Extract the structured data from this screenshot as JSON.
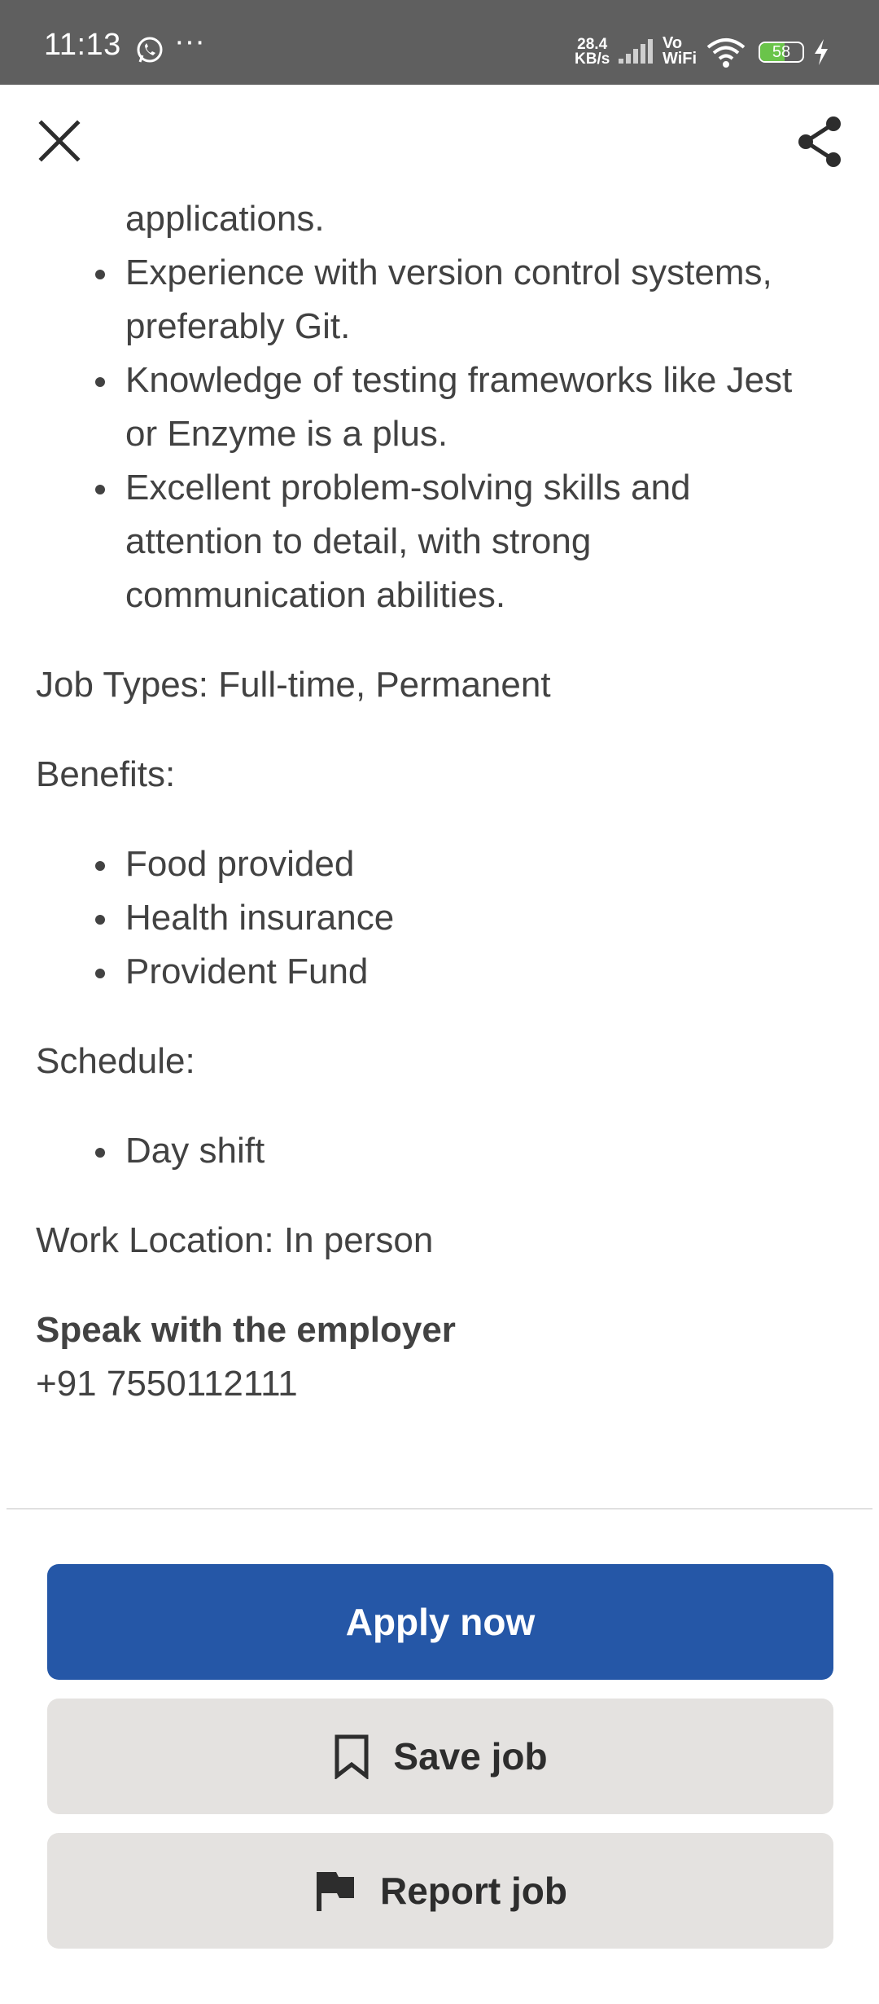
{
  "status_bar": {
    "time": "11:13",
    "dots": "···",
    "speed_value": "28.4",
    "speed_unit": "KB/s",
    "network_vo": "Vo",
    "network_wifi": "WiFi",
    "battery_level": "58",
    "battery_fraction": 0.58,
    "icons": [
      "whatsapp-icon",
      "signal-icon",
      "wifi-icon",
      "battery-icon",
      "charging-bolt-icon"
    ]
  },
  "header": {
    "icons": [
      "close-icon",
      "share-icon"
    ]
  },
  "requirements": {
    "continuation": "applications.",
    "items": [
      [
        "Experience with version control systems,",
        "preferably Git."
      ],
      [
        "Knowledge of testing frameworks like Jest",
        "or Enzyme is a plus."
      ],
      [
        "Excellent problem-solving skills and",
        "attention to detail, with strong",
        "communication abilities."
      ]
    ]
  },
  "job_types": "Job Types: Full-time, Permanent",
  "benefits": {
    "heading": "Benefits:",
    "items": [
      "Food provided",
      "Health insurance",
      "Provident Fund"
    ]
  },
  "schedule": {
    "heading": "Schedule:",
    "items": [
      "Day shift"
    ]
  },
  "work_location": "Work Location: In person",
  "employer": {
    "heading": "Speak with the employer",
    "phone": "+91 7550112111"
  },
  "actions": {
    "apply_label": "Apply now",
    "save_label": "Save job",
    "report_label": "Report job",
    "apply_color": "#2557a7",
    "secondary_color": "#e4e2e0",
    "icons": [
      "bookmark-icon",
      "flag-icon"
    ]
  }
}
